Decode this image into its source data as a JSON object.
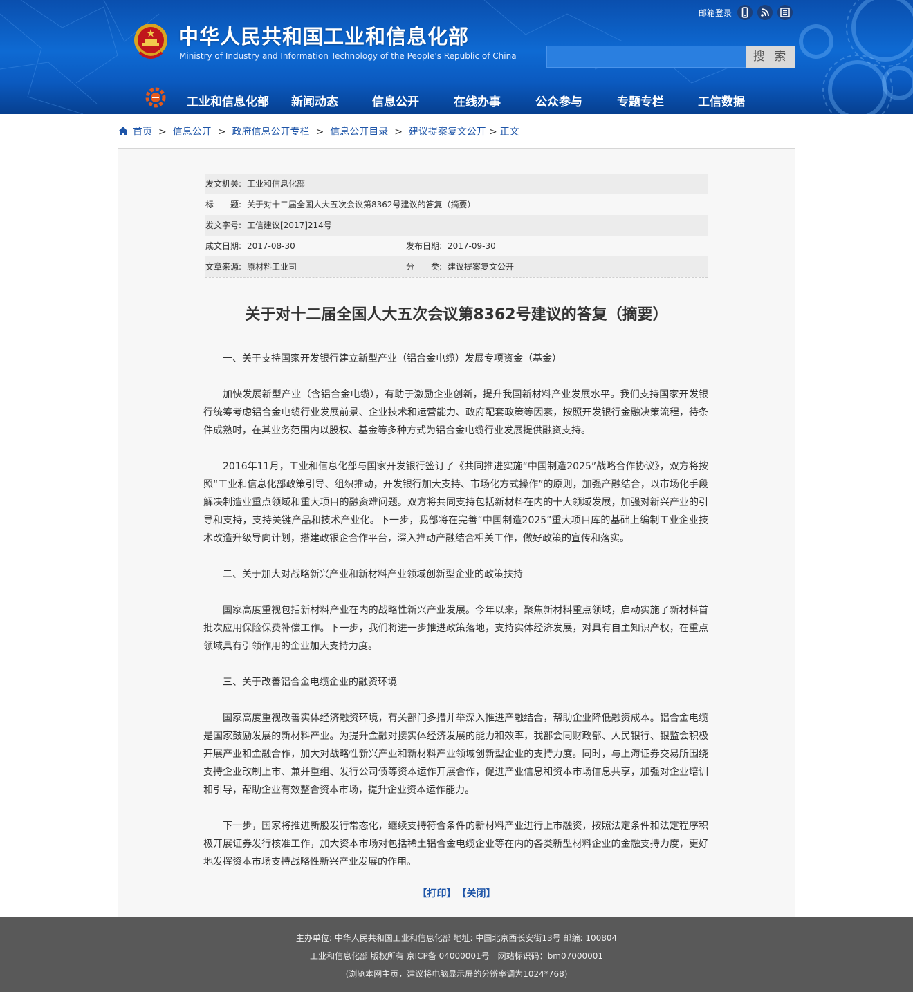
{
  "header": {
    "site_title": "中华人民共和国工业和信息化部",
    "site_subtitle": "Ministry of Industry and Information Technology of the People's Republic of China",
    "mail_login": "邮箱登录",
    "top_icons": [
      "mobile-icon",
      "rss-icon",
      "newspaper-icon"
    ],
    "search": {
      "placeholder": "",
      "button_label": "搜 索"
    },
    "nav": [
      "工业和信息化部",
      "新闻动态",
      "信息公开",
      "在线办事",
      "公众参与",
      "专题专栏",
      "工信数据"
    ]
  },
  "breadcrumb": {
    "items": [
      "首页",
      "信息公开",
      "政府信息公开专栏",
      "信息公开目录",
      "建议提案复文公开"
    ],
    "separator": ">",
    "current": "正文"
  },
  "meta": {
    "issuer_label": "发文机关:",
    "issuer": "工业和信息化部",
    "title_label": "标　　题:",
    "title": "关于对十二届全国人大五次会议第8362号建议的答复（摘要）",
    "doc_no_label": "发文字号:",
    "doc_no": "工信建议[2017]214号",
    "written_date_label": "成文日期:",
    "written_date": "2017-08-30",
    "publish_date_label": "发布日期:",
    "publish_date": "2017-09-30",
    "source_label": "文章来源:",
    "source": "原材料工业司",
    "category_label": "分　　类:",
    "category": "建议提案复文公开"
  },
  "article": {
    "title": "关于对十二届全国人大五次会议第8362号建议的答复（摘要）",
    "paragraphs": [
      "一、关于支持国家开发银行建立新型产业（铝合金电缆）发展专项资金（基金）",
      "加快发展新型产业（含铝合金电缆），有助于激励企业创新，提升我国新材料产业发展水平。我们支持国家开发银行统筹考虑铝合金电缆行业发展前景、企业技术和运营能力、政府配套政策等因素，按照开发银行金融决策流程，待条件成熟时，在其业务范围内以股权、基金等多种方式为铝合金电缆行业发展提供融资支持。",
      "2016年11月，工业和信息化部与国家开发银行签订了《共同推进实施“中国制造2025”战略合作协议》，双方将按照“工业和信息化部政策引导、组织推动，开发银行加大支持、市场化方式操作”的原则，加强产融结合，以市场化手段解决制造业重点领域和重大项目的融资难问题。双方将共同支持包括新材料在内的十大领域发展，加强对新兴产业的引导和支持，支持关键产品和技术产业化。下一步，我部将在完善“中国制造2025”重大项目库的基础上编制工业企业技术改造升级导向计划，搭建政银企合作平台，深入推动产融结合相关工作，做好政策的宣传和落实。",
      "二、关于加大对战略新兴产业和新材料产业领域创新型企业的政策扶持",
      "国家高度重视包括新材料产业在内的战略性新兴产业发展。今年以来，聚焦新材料重点领域，启动实施了新材料首批次应用保险保费补偿工作。下一步，我们将进一步推进政策落地，支持实体经济发展，对具有自主知识产权，在重点领域具有引领作用的企业加大支持力度。",
      "三、关于改善铝合金电缆企业的融资环境",
      "国家高度重视改善实体经济融资环境，有关部门多措并举深入推进产融结合，帮助企业降低融资成本。铝合金电缆是国家鼓励发展的新材料产业。为提升金融对接实体经济发展的能力和效率，我部会同财政部、人民银行、银监会积极开展产业和金融合作，加大对战略性新兴产业和新材料产业领域创新型企业的支持力度。同时，与上海证券交易所围绕支持企业改制上市、兼并重组、发行公司债等资本运作开展合作，促进产业信息和资本市场信息共享，加强对企业培训和引导，帮助企业有效整合资本市场，提升企业资本运作能力。",
      "下一步，国家将推进新股发行常态化，继续支持符合条件的新材料产业进行上市融资，按照法定条件和法定程序积极开展证券发行核准工作，加大资本市场对包括稀土铝合金电缆企业等在内的各类新型材料企业的金融支持力度，更好地发挥资本市场支持战略性新兴产业发展的作用。"
    ]
  },
  "actions": {
    "print": "【打印】",
    "close": "【关闭】"
  },
  "footer": {
    "line1": "主办单位: 中华人民共和国工业和信息化部 地址: 中国北京西长安街13号 邮编: 100804",
    "line2": "工业和信息化部 版权所有 京ICP备 04000001号　网站标识码：bm07000001",
    "line3": "(浏览本网主页，建议将电脑显示屏的分辨率调为1024*768)"
  },
  "colors": {
    "header_blue": "#0e6ad3",
    "link_blue": "#1e55a8",
    "footer_gray": "#595959"
  }
}
